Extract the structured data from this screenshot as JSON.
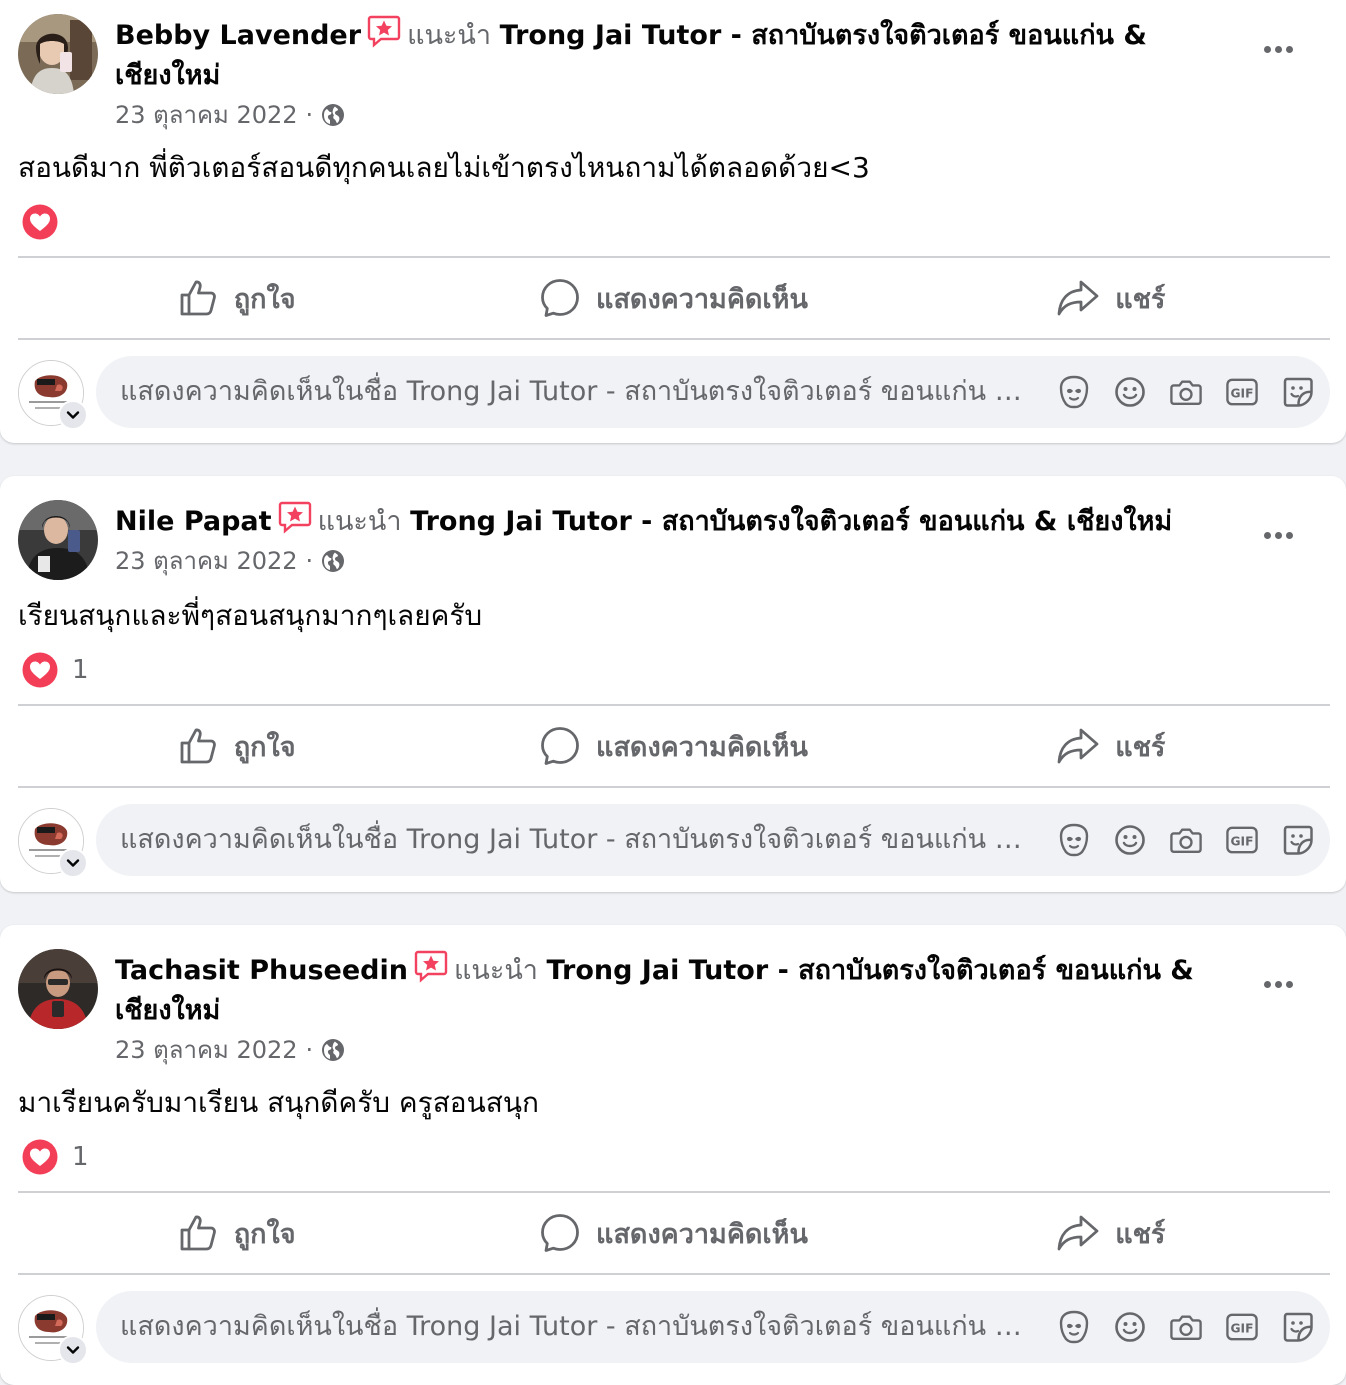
{
  "common": {
    "recommends_text": "แนะนำ",
    "page_name": "Trong Jai Tutor - สถาบันตรงใจติวเตอร์ ขอนแก่น & เชียงใหม่",
    "like_label": "ถูกใจ",
    "comment_label": "แสดงความคิดเห็น",
    "share_label": "แชร์",
    "comment_placeholder": "แสดงความคิดเห็นในชื่อ Trong Jai Tutor - สถาบันตรงใจติวเตอร์ ขอนแก่น & เชียงใหม่",
    "separator": "·"
  },
  "colors": {
    "secondary_text": "#65676b",
    "recommend_badge": "#f3425f",
    "love_reaction": "#f33e58",
    "divider": "#ced0d4"
  },
  "posts": [
    {
      "author": "Bebby Lavender",
      "page_line_1": "Trong Jai Tutor - สถาบันตรงใจติวเตอร์ ขอนแก่น &",
      "page_line_2": "เชียงใหม่",
      "date": "23 ตุลาคม 2022",
      "text": "สอนดีมาก พี่ติวเตอร์สอนดีทุกคนเลยไม่เข้าตรงไหนถามได้ตลอดด้วย<3",
      "reaction_count": ""
    },
    {
      "author": "Nile Papat",
      "page_line_1": "Trong Jai Tutor - สถาบันตรงใจติวเตอร์ ขอนแก่น & เชียงใหม่",
      "date": "23 ตุลาคม 2022",
      "text": "เรียนสนุกและพี่ๆสอนสนุกมากๆเลยครับ",
      "reaction_count": "1"
    },
    {
      "author": "Tachasit Phuseedin",
      "page_line_1": "Trong Jai Tutor - สถาบันตรงใจติวเตอร์ ขอนแก่น &",
      "page_line_2": "เชียงใหม่",
      "date": "23 ตุลาคม 2022",
      "text": "มาเรียนครับมาเรียน สนุกดีครับ ครูสอนสนุก",
      "reaction_count": "1"
    }
  ]
}
